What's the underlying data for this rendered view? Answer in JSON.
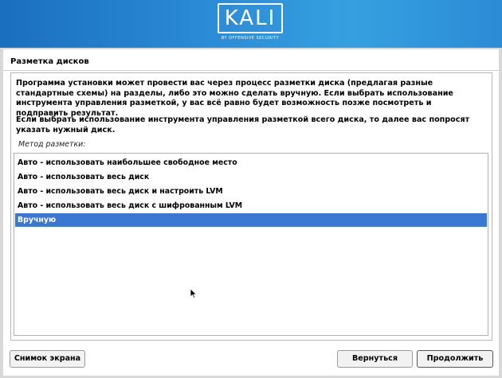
{
  "banner": {
    "logo_text": "KALI",
    "logo_subtext": "BY OFFENSIVE SECURITY"
  },
  "page": {
    "title": "Разметка дисков"
  },
  "content": {
    "paragraph1": "Программа установки может провести вас через процесс разметки диска (предлагая разные стандартные схемы) на разделы, либо это можно сделать вручную. Если выбрать использование инструмента управления разметкой, у вас всё равно будет возможность позже посмотреть и подправить результат.",
    "paragraph2": "Если выбрать использование инструмента управления разметкой всего диска, то далее вас попросят указать нужный диск.",
    "method_label": "Метод разметки:"
  },
  "methods": {
    "items": [
      "Авто - использовать наибольшее свободное место",
      "Авто - использовать весь диск",
      "Авто - использовать весь диск и настроить LVM",
      "Авто - использовать весь диск с шифрованным LVM",
      "Вручную"
    ],
    "selected": "Вручную"
  },
  "buttons": {
    "screenshot": "Снимок экрана",
    "back": "Вернуться",
    "continue": "Продолжить"
  },
  "colors": {
    "banner": "#2a8ad6",
    "selection": "#3a78d4"
  }
}
